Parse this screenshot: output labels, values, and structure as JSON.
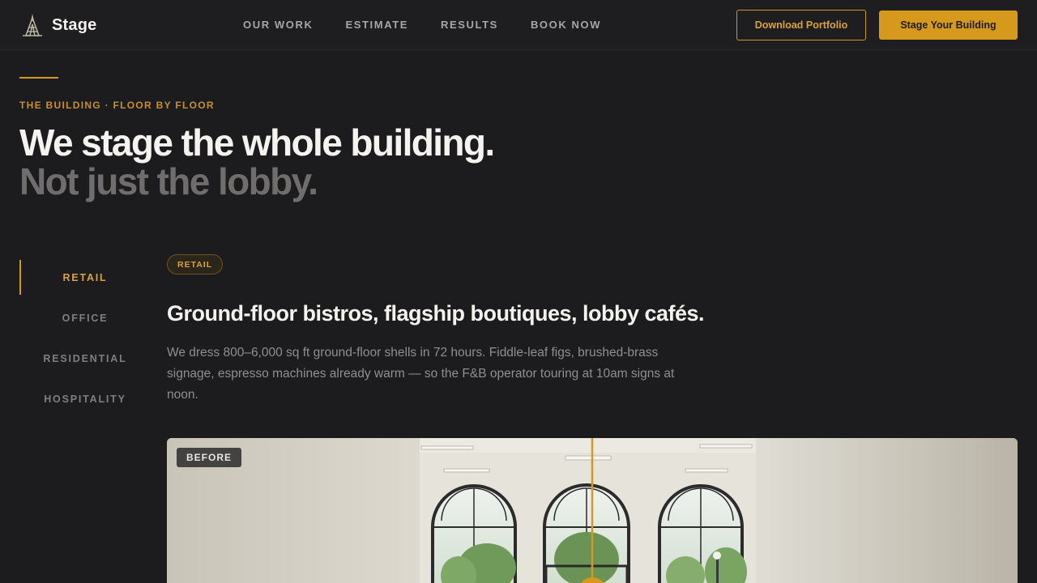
{
  "brand": {
    "name": "Stage",
    "logo_icon": "tower-icon"
  },
  "nav": {
    "items": [
      "OUR WORK",
      "ESTIMATE",
      "RESULTS",
      "BOOK NOW"
    ]
  },
  "header_actions": {
    "download_label": "Download Portfolio",
    "cta_label": "Stage Your Building"
  },
  "hero": {
    "eyebrow": "THE BUILDING · FLOOR BY FLOOR",
    "headline": "We stage the whole building.",
    "subheadline": "Not just the lobby."
  },
  "tabs": {
    "items": [
      "RETAIL",
      "OFFICE",
      "RESIDENTIAL",
      "HOSPITALITY"
    ],
    "active": "RETAIL"
  },
  "content": {
    "pill": "RETAIL",
    "title": "Ground-floor bistros, flagship boutiques, lobby cafés.",
    "description": "We dress 800–6,000 sq ft ground-floor shells in 72 hours. Fiddle-leaf figs, brushed-brass signage, espresso machines already warm — so the F&B operator touring at 10am signs at noon."
  },
  "comparison": {
    "before_label": "BEFORE",
    "handle_icon": "compare-slider-handle"
  },
  "colors": {
    "accent": "#d6991c",
    "background": "#1c1c1e",
    "muted_text": "#8f8f8f"
  }
}
